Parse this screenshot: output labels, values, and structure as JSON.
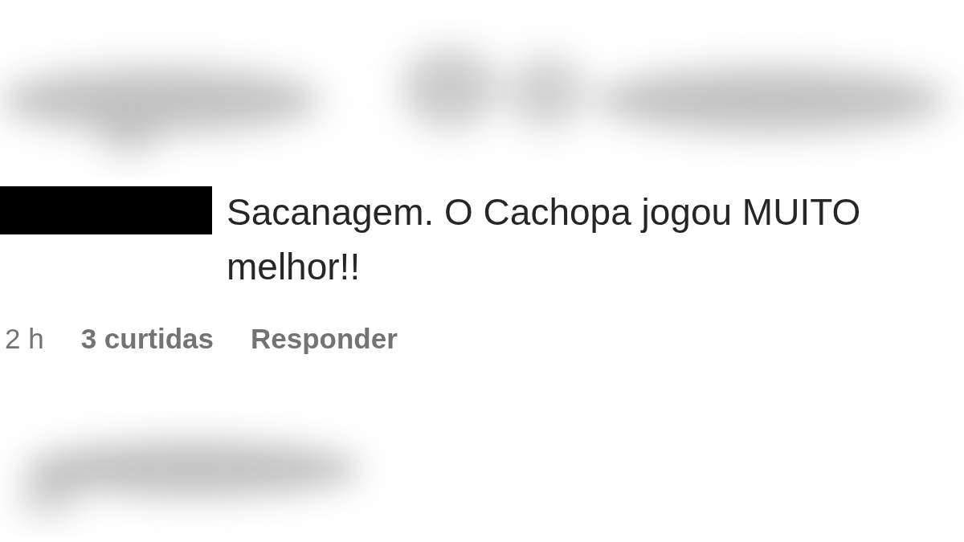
{
  "comment": {
    "text": "Sacanagem. O Cachopa jogou MUITO melhor!!",
    "time": "2 h",
    "likes": "3 curtidas",
    "reply": "Responder"
  }
}
